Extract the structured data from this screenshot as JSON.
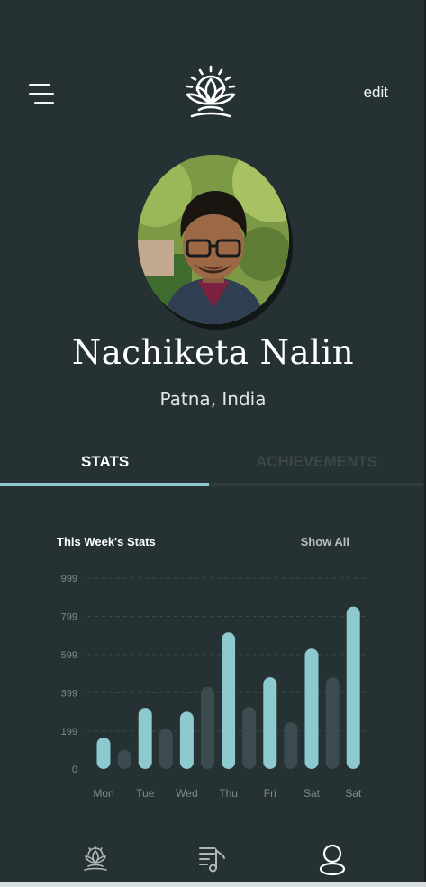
{
  "header": {
    "menu_icon": "hamburger-menu-icon",
    "logo_icon": "lotus-sun-logo-icon",
    "edit_label": "edit"
  },
  "profile": {
    "avatar": "profile-photo",
    "name": "Nachiketa Nalin",
    "location": "Patna, India"
  },
  "tabs": [
    {
      "label": "STATS",
      "active": true
    },
    {
      "label": "ACHIEVEMENTS",
      "active": false
    }
  ],
  "stats": {
    "title": "This Week's Stats",
    "show_all_label": "Show All"
  },
  "chart_data": {
    "type": "bar",
    "title": "",
    "xlabel": "",
    "ylabel": "",
    "ylim": [
      0,
      999
    ],
    "yticks": [
      "0",
      "199",
      "399",
      "599",
      "799",
      "999"
    ],
    "grid": true,
    "bars": [
      {
        "value": 165,
        "highlight": true
      },
      {
        "value": 100,
        "highlight": false
      },
      {
        "value": 320,
        "highlight": true
      },
      {
        "value": 210,
        "highlight": false
      },
      {
        "value": 300,
        "highlight": true
      },
      {
        "value": 430,
        "highlight": false
      },
      {
        "value": 715,
        "highlight": true
      },
      {
        "value": 325,
        "highlight": false
      },
      {
        "value": 480,
        "highlight": true
      },
      {
        "value": 245,
        "highlight": false
      },
      {
        "value": 630,
        "highlight": true
      },
      {
        "value": 480,
        "highlight": false
      },
      {
        "value": 850,
        "highlight": true
      }
    ],
    "xlabels": [
      "Mon",
      "Tue",
      "Wed",
      "Thu",
      "Fri",
      "Sat",
      "Sat"
    ],
    "colors": {
      "highlight": "#8dcad0",
      "muted": "#3c4c4e"
    }
  },
  "bottom_nav": [
    {
      "icon": "meditation-lotus-icon"
    },
    {
      "icon": "music-playlist-icon"
    },
    {
      "icon": "profile-user-icon",
      "active": true
    }
  ],
  "colors": {
    "background": "#263133",
    "accent": "#8dcad0",
    "text": "#ffffff",
    "muted_text": "#b6bfbf"
  }
}
